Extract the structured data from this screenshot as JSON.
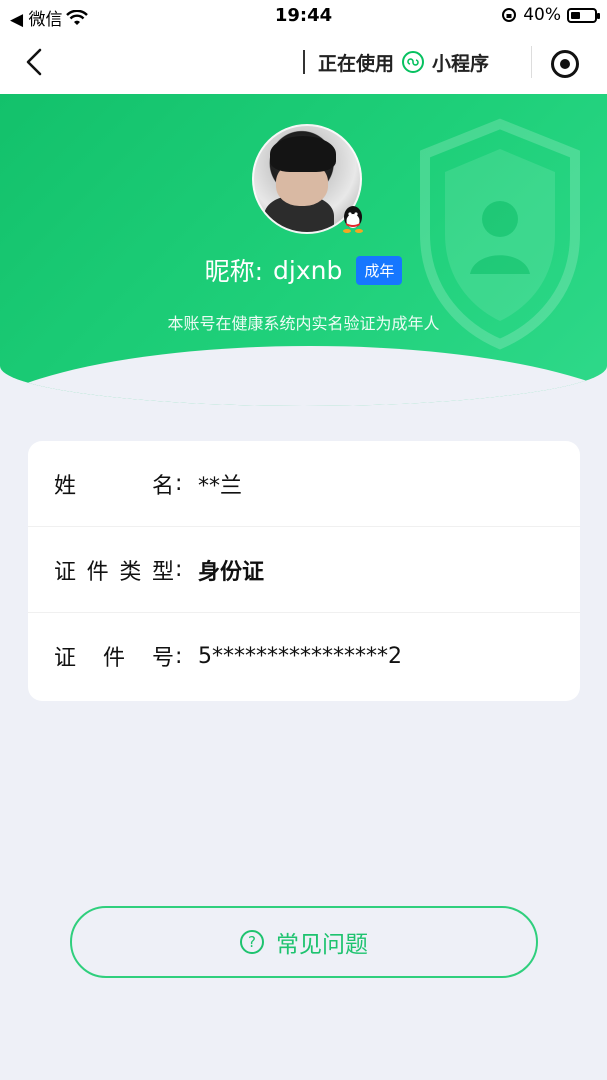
{
  "status_bar": {
    "back_app": "◀ 微信",
    "time": "19:44",
    "battery_percent": "40%",
    "battery_level": 0.4
  },
  "nav": {
    "in_use_label": "正在使用",
    "mini_program_label": "小程序"
  },
  "profile": {
    "nickname_label": "昵称:",
    "nickname": "djxnb",
    "adult_badge": "成年",
    "verify_note": "本账号在健康系统内实名验证为成年人"
  },
  "info": {
    "rows": [
      {
        "label_chars": [
          "姓",
          "名"
        ],
        "value": "**兰",
        "bold": false
      },
      {
        "label_chars": [
          "证",
          "件",
          "类",
          "型"
        ],
        "value": "身份证",
        "bold": true
      },
      {
        "label_chars": [
          "证",
          "件",
          "号"
        ],
        "value": "5****************2",
        "bold": false
      }
    ],
    "colon": ":"
  },
  "faq": {
    "label": "常见问题",
    "icon_glyph": "?"
  },
  "colors": {
    "brand_green": "#1ec36f",
    "badge_blue": "#1677ff",
    "page_bg": "#eef0f7"
  }
}
